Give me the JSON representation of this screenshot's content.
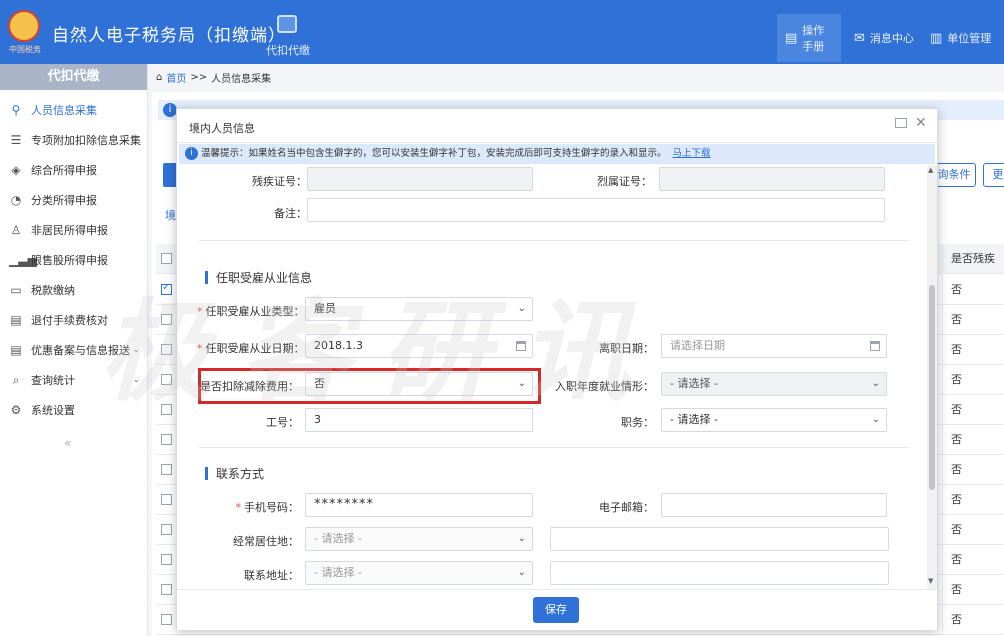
{
  "header": {
    "logo_caption": "中国税务",
    "title": "自然人电子税务局（扣缴端）",
    "nav_item": "代扣代缴",
    "right_items": [
      "操作手册",
      "消息中心",
      "单位管理"
    ]
  },
  "sidebar": {
    "heading": "代扣代缴",
    "items": [
      {
        "label": "人员信息采集",
        "icon": "person-icon"
      },
      {
        "label": "专项附加扣除信息采集",
        "icon": "list-icon"
      },
      {
        "label": "综合所得申报",
        "icon": "layers-icon"
      },
      {
        "label": "分类所得申报",
        "icon": "pie-icon"
      },
      {
        "label": "非居民所得申报",
        "icon": "user-icon"
      },
      {
        "label": "限售股所得申报",
        "icon": "bars-icon"
      },
      {
        "label": "税款缴纳",
        "icon": "folder-icon"
      },
      {
        "label": "退付手续费核对",
        "icon": "doc-icon"
      },
      {
        "label": "优惠备案与信息报送",
        "icon": "doc-icon"
      },
      {
        "label": "查询统计",
        "icon": "search-icon"
      },
      {
        "label": "系统设置",
        "icon": "gear-icon"
      }
    ],
    "collapse": "«"
  },
  "breadcrumb": {
    "home": "首页",
    "sep": ">>",
    "current": "人员信息采集"
  },
  "background": {
    "tab_fragment": "境",
    "btn_conditions": "询条件",
    "btn_more": "更",
    "last_col_header": "是否残疾",
    "last_col_values": [
      "否",
      "否",
      "否",
      "否",
      "否",
      "否",
      "否",
      "否",
      "否",
      "否",
      "否",
      "否"
    ]
  },
  "modal": {
    "title": "境内人员信息",
    "tip": "温馨提示：如果姓名当中包含生僻字的，您可以安装生僻字补丁包，安装完成后即可支持生僻字的录入和显示。",
    "tip_link": "马上下载",
    "fields": {
      "disability_no_label": "残疾证号：",
      "martyr_no_label": "烈属证号：",
      "remark_label": "备注：",
      "employment_type_label": "任职受雇从业类型：",
      "employment_type_value": "雇员",
      "employment_date_label": "任职受雇从业日期：",
      "employment_date_value": "2018.1.3",
      "leave_date_label": "离职日期：",
      "leave_date_placeholder": "请选择日期",
      "deduct_fee_label": "是否扣除减除费用：",
      "deduct_fee_value": "否",
      "entry_year_label": "入职年度就业情形：",
      "entry_year_value": "- 请选择 -",
      "job_no_label": "工号：",
      "job_no_value": "3",
      "position_label": "职务：",
      "position_value": "- 请选择 -",
      "phone_label": "手机号码：",
      "phone_value": "********",
      "email_label": "电子邮箱：",
      "residence_label": "经常居住地：",
      "residence_value": "- 请选择 -",
      "contact_addr_label": "联系地址：",
      "contact_addr_value": "- 请选择 -"
    },
    "sections": {
      "employment": "任职受雇从业信息",
      "contact": "联系方式"
    },
    "save": "保存"
  },
  "watermark": "极客研讯"
}
